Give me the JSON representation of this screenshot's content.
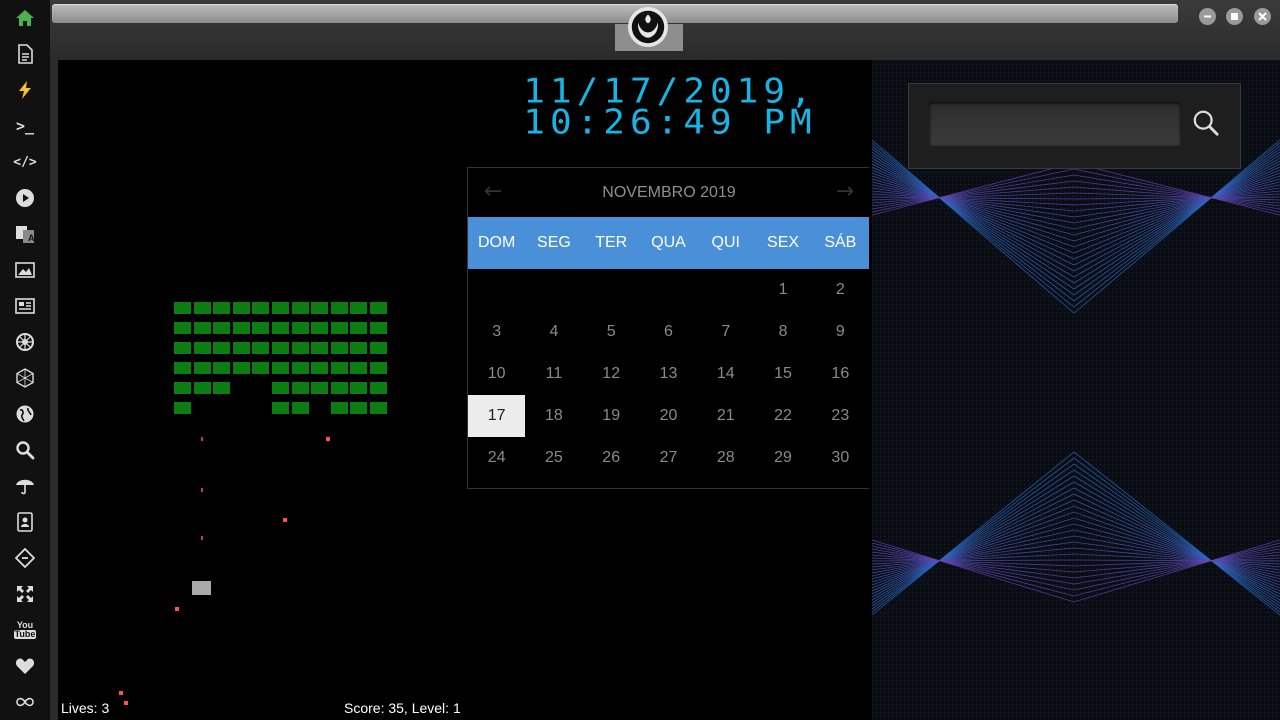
{
  "sidebar": {
    "items": [
      {
        "name": "home-icon"
      },
      {
        "name": "document-icon"
      },
      {
        "name": "lightning-icon"
      },
      {
        "name": "terminal-icon",
        "label": ">_"
      },
      {
        "name": "code-icon",
        "label": "</>"
      },
      {
        "name": "play-icon"
      },
      {
        "name": "translate-icon"
      },
      {
        "name": "image-icon"
      },
      {
        "name": "news-icon"
      },
      {
        "name": "rebel-icon"
      },
      {
        "name": "hexagon-icon"
      },
      {
        "name": "globe-icon"
      },
      {
        "name": "search-icon"
      },
      {
        "name": "umbrella-icon"
      },
      {
        "name": "contacts-icon"
      },
      {
        "name": "git-icon"
      },
      {
        "name": "expand-icon"
      },
      {
        "name": "youtube-icon",
        "label_top": "You",
        "label_bottom": "Tube"
      },
      {
        "name": "heart-icon"
      },
      {
        "name": "infinity-icon"
      }
    ]
  },
  "game": {
    "lives_text": "Lives: 3",
    "score_text": "Score: 35, Level: 1"
  },
  "clock": {
    "date": "11/17/2019,",
    "time": "10:26:49 PM"
  },
  "calendar": {
    "title": "NOVEMBRO 2019",
    "prev_label": "←",
    "next_label": "→",
    "weekdays": [
      "DOM",
      "SEG",
      "TER",
      "QUA",
      "QUI",
      "SEX",
      "SÁB"
    ],
    "weeks": [
      [
        "",
        "",
        "",
        "",
        "",
        "1",
        "2"
      ],
      [
        "3",
        "4",
        "5",
        "6",
        "7",
        "8",
        "9"
      ],
      [
        "10",
        "11",
        "12",
        "13",
        "14",
        "15",
        "16"
      ],
      [
        "17",
        "18",
        "19",
        "20",
        "21",
        "22",
        "23"
      ],
      [
        "24",
        "25",
        "26",
        "27",
        "28",
        "29",
        "30"
      ]
    ],
    "today": "17"
  },
  "search": {
    "value": ""
  },
  "colors": {
    "clock": "#16b5e6",
    "calendar_header": "#4a90d9",
    "brick": "#0c7d12",
    "projectile": "#ff5050"
  }
}
